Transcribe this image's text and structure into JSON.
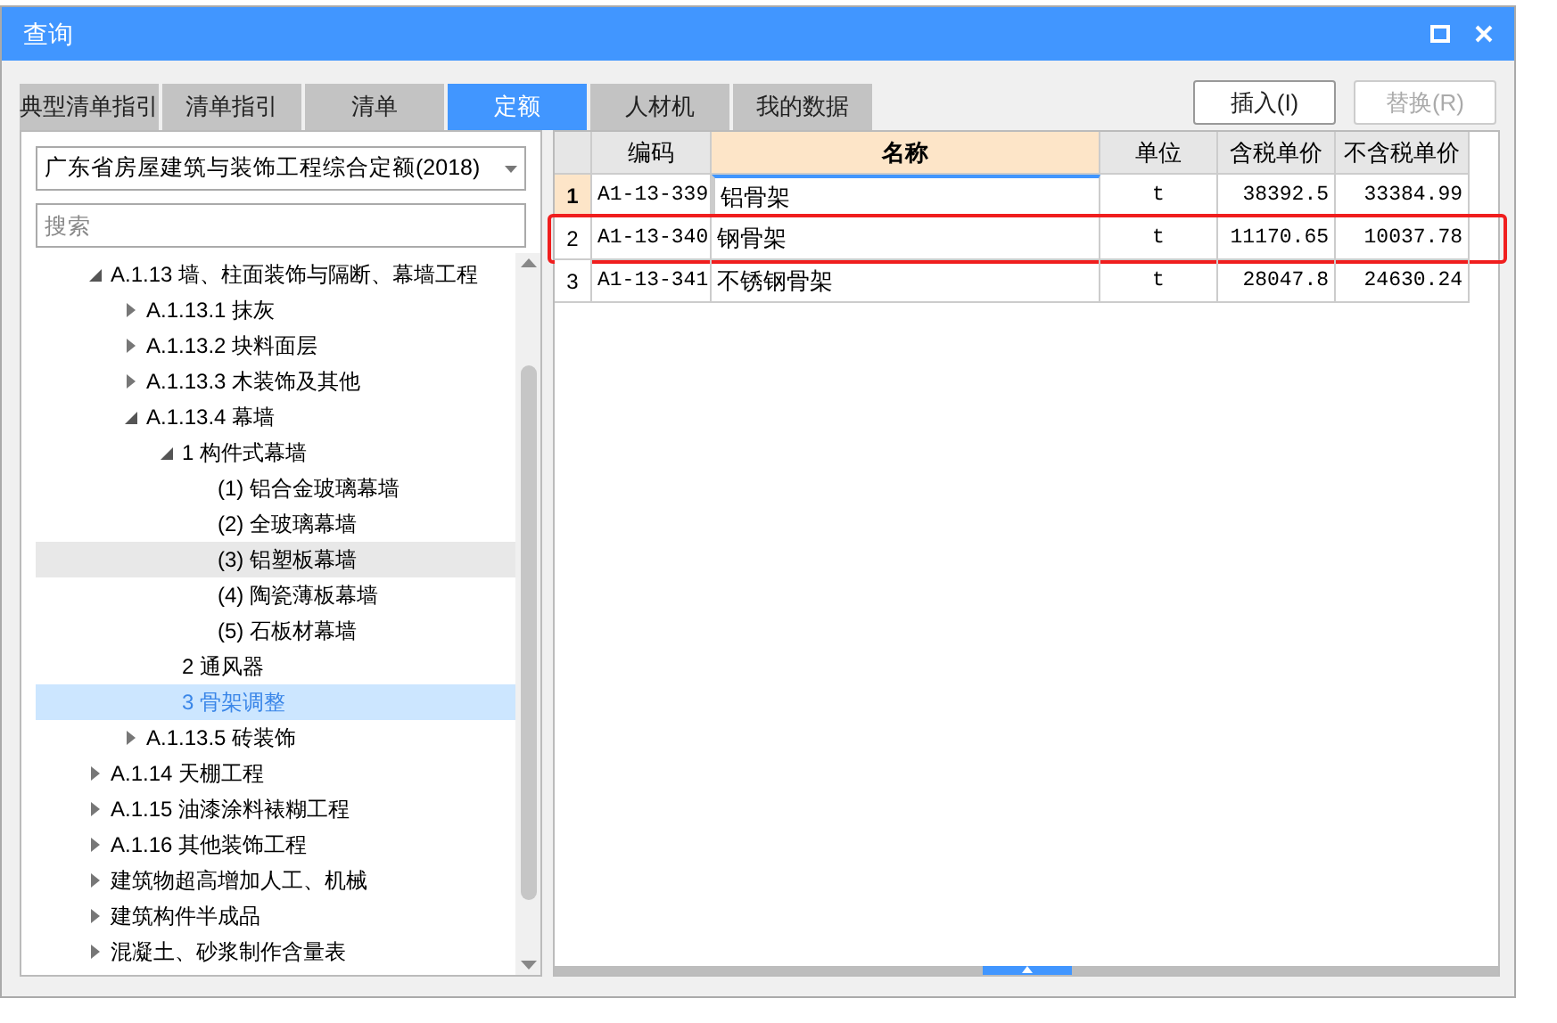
{
  "window": {
    "title": "查询"
  },
  "tabs": [
    {
      "label": "典型清单指引",
      "selected": false
    },
    {
      "label": "清单指引",
      "selected": false
    },
    {
      "label": "清单",
      "selected": false
    },
    {
      "label": "定额",
      "selected": true
    },
    {
      "label": "人材机",
      "selected": false
    },
    {
      "label": "我的数据",
      "selected": false
    }
  ],
  "buttons": [
    {
      "label": "插入(I)",
      "disabled": false
    },
    {
      "label": "替换(R)",
      "disabled": true
    }
  ],
  "library_select": {
    "value": "广东省房屋建筑与装饰工程综合定额(2018)"
  },
  "search": {
    "placeholder": "搜索"
  },
  "tree": [
    {
      "label": "A.1.13 墙、柱面装饰与隔断、幕墙工程",
      "expanded": true,
      "selected": false,
      "hovered": false,
      "children": [
        {
          "label": "A.1.13.1 抹灰",
          "expanded": false,
          "selected": false,
          "hovered": false
        },
        {
          "label": "A.1.13.2 块料面层",
          "expanded": false,
          "selected": false,
          "hovered": false
        },
        {
          "label": "A.1.13.3 木装饰及其他",
          "expanded": false,
          "selected": false,
          "hovered": false
        },
        {
          "label": "A.1.13.4 幕墙",
          "expanded": true,
          "selected": false,
          "hovered": false,
          "children": [
            {
              "label": "1 构件式幕墙",
              "expanded": true,
              "selected": false,
              "hovered": false,
              "children": [
                {
                  "label": "(1) 铝合金玻璃幕墙",
                  "selected": false,
                  "hovered": false
                },
                {
                  "label": "(2) 全玻璃幕墙",
                  "selected": false,
                  "hovered": false
                },
                {
                  "label": "(3) 铝塑板幕墙",
                  "selected": false,
                  "hovered": true
                },
                {
                  "label": "(4) 陶瓷薄板幕墙",
                  "selected": false,
                  "hovered": false
                },
                {
                  "label": "(5) 石板材幕墙",
                  "selected": false,
                  "hovered": false
                }
              ]
            },
            {
              "label": "2 通风器",
              "selected": false,
              "hovered": false
            },
            {
              "label": "3 骨架调整",
              "selected": true,
              "hovered": false
            }
          ]
        },
        {
          "label": "A.1.13.5 砖装饰",
          "expanded": false,
          "selected": false,
          "hovered": false
        }
      ]
    },
    {
      "label": "A.1.14 天棚工程",
      "expanded": false,
      "selected": false,
      "hovered": false
    },
    {
      "label": "A.1.15 油漆涂料裱糊工程",
      "expanded": false,
      "selected": false,
      "hovered": false
    },
    {
      "label": "A.1.16 其他装饰工程",
      "expanded": false,
      "selected": false,
      "hovered": false
    },
    {
      "label": "建筑物超高增加人工、机械",
      "expanded": false,
      "selected": false,
      "hovered": false
    },
    {
      "label": "建筑构件半成品",
      "expanded": false,
      "selected": false,
      "hovered": false
    },
    {
      "label": "混凝土、砂浆制作含量表",
      "expanded": false,
      "selected": false,
      "hovered": false
    }
  ],
  "table": {
    "columns": [
      "编码",
      "名称",
      "单位",
      "含税单价",
      "不含税单价"
    ],
    "rows": [
      {
        "index": "1",
        "cells": [
          "A1-13-339",
          "铝骨架",
          "t",
          "38392.5",
          "33384.99"
        ],
        "selected": true,
        "highlighted": false
      },
      {
        "index": "2",
        "cells": [
          "A1-13-340",
          "钢骨架",
          "t",
          "11170.65",
          "10037.78"
        ],
        "selected": false,
        "highlighted": true
      },
      {
        "index": "3",
        "cells": [
          "A1-13-341",
          "不锈钢骨架",
          "t",
          "28047.8",
          "24630.24"
        ],
        "selected": false,
        "highlighted": false
      }
    ]
  }
}
